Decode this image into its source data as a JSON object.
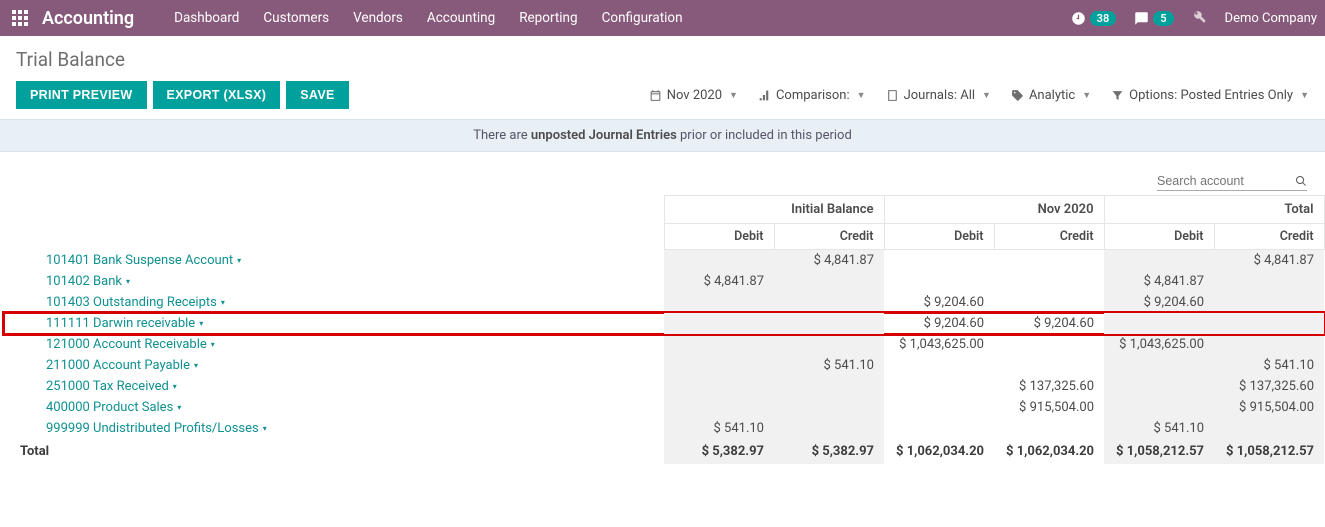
{
  "navbar": {
    "brand": "Accounting",
    "menu": [
      "Dashboard",
      "Customers",
      "Vendors",
      "Accounting",
      "Reporting",
      "Configuration"
    ],
    "clock_count": "38",
    "chat_count": "5",
    "company": "Demo Company"
  },
  "page": {
    "title": "Trial Balance",
    "buttons": {
      "print": "Print Preview",
      "export": "Export (XLSX)",
      "save": "Save"
    },
    "filters": {
      "date_label": "Nov 2020",
      "comparison_label": "Comparison:",
      "journals_label": "Journals: All",
      "analytic_label": "Analytic",
      "options_label": "Options: Posted Entries Only"
    },
    "notice_pre": "There are ",
    "notice_bold": "unposted Journal Entries",
    "notice_post": " prior or included in this period",
    "search_placeholder": "Search account"
  },
  "table": {
    "groups": [
      "Initial Balance",
      "Nov 2020",
      "Total"
    ],
    "sub": [
      "Debit",
      "Credit",
      "Debit",
      "Credit",
      "Debit",
      "Credit"
    ],
    "rows": [
      {
        "name": "101401 Bank Suspense Account",
        "v": [
          "",
          "$ 4,841.87",
          "",
          "",
          "",
          "$ 4,841.87"
        ]
      },
      {
        "name": "101402 Bank",
        "v": [
          "$ 4,841.87",
          "",
          "",
          "",
          "$ 4,841.87",
          ""
        ]
      },
      {
        "name": "101403 Outstanding Receipts",
        "v": [
          "",
          "",
          "$ 9,204.60",
          "",
          "$ 9,204.60",
          ""
        ]
      },
      {
        "name": "111111 Darwin receivable",
        "v": [
          "",
          "",
          "$ 9,204.60",
          "$ 9,204.60",
          "",
          ""
        ],
        "highlight": true
      },
      {
        "name": "121000 Account Receivable",
        "v": [
          "",
          "",
          "$ 1,043,625.00",
          "",
          "$ 1,043,625.00",
          ""
        ]
      },
      {
        "name": "211000 Account Payable",
        "v": [
          "",
          "$ 541.10",
          "",
          "",
          "",
          "$ 541.10"
        ]
      },
      {
        "name": "251000 Tax Received",
        "v": [
          "",
          "",
          "",
          "$ 137,325.60",
          "",
          "$ 137,325.60"
        ]
      },
      {
        "name": "400000 Product Sales",
        "v": [
          "",
          "",
          "",
          "$ 915,504.00",
          "",
          "$ 915,504.00"
        ]
      },
      {
        "name": "999999 Undistributed Profits/Losses",
        "v": [
          "$ 541.10",
          "",
          "",
          "",
          "$ 541.10",
          ""
        ]
      }
    ],
    "total_label": "Total",
    "totals": [
      "$ 5,382.97",
      "$ 5,382.97",
      "$ 1,062,034.20",
      "$ 1,062,034.20",
      "$ 1,058,212.57",
      "$ 1,058,212.57"
    ]
  }
}
